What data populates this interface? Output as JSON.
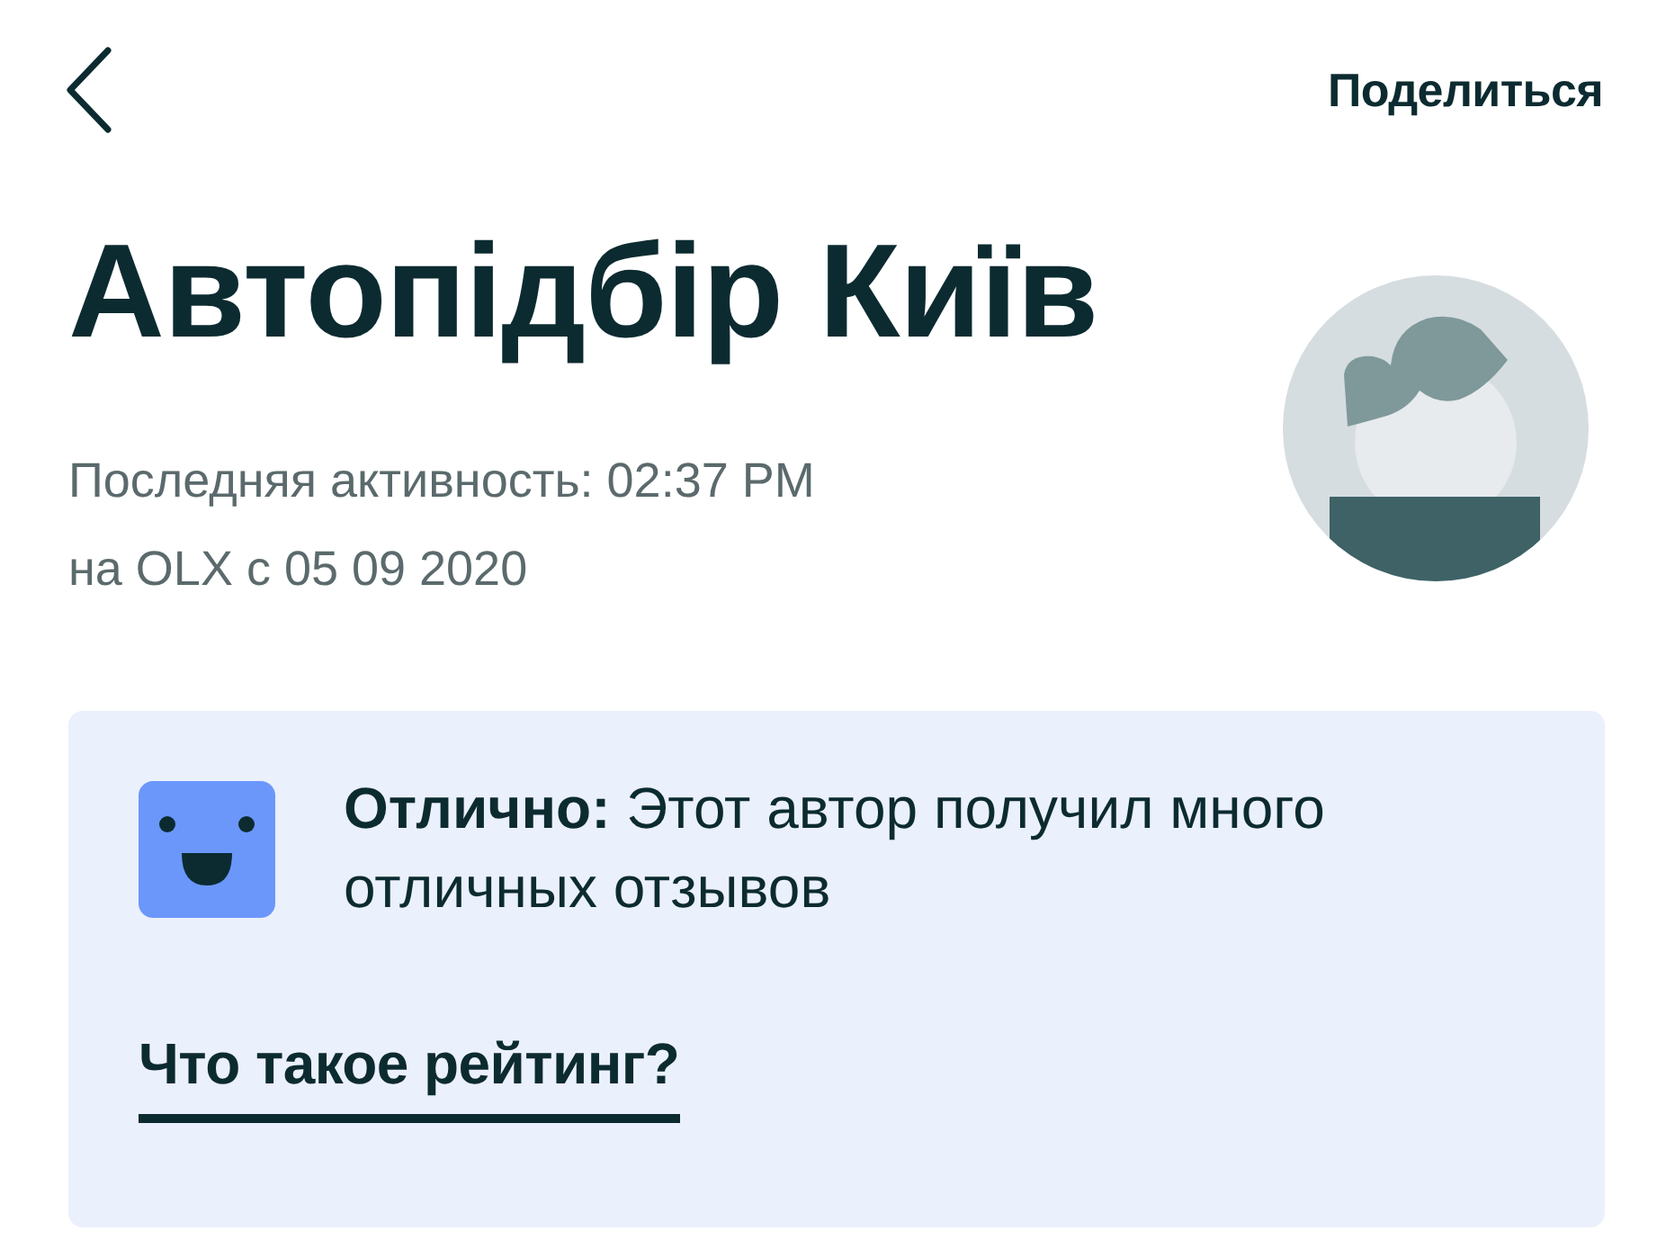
{
  "header": {
    "share_label": "Поделиться"
  },
  "profile": {
    "name": "Автопідбір Київ",
    "last_activity": "Последняя активность: 02:37 PM",
    "member_since": "на OLX с 05 09 2020"
  },
  "rating_card": {
    "message": "**Отлично:** Этот автор получил много отличных отзывов",
    "link": "Что такое рейтинг?"
  }
}
